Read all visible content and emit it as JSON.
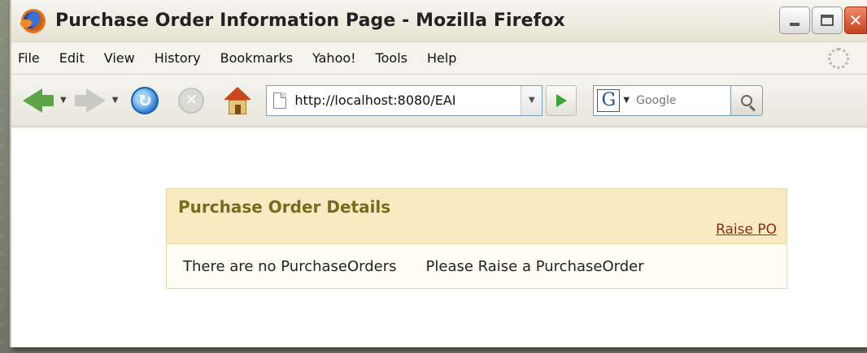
{
  "window": {
    "title": "Purchase Order Information Page - Mozilla Firefox",
    "buttons": {
      "minimize": "minimize",
      "maximize": "maximize",
      "close": "close"
    }
  },
  "menu": {
    "items": [
      {
        "label": "File"
      },
      {
        "label": "Edit"
      },
      {
        "label": "View"
      },
      {
        "label": "History"
      },
      {
        "label": "Bookmarks"
      },
      {
        "label": "Yahoo!"
      },
      {
        "label": "Tools"
      },
      {
        "label": "Help"
      }
    ]
  },
  "toolbar": {
    "url": "http://localhost:8080/EAI",
    "search_engine_letter": "G",
    "search_placeholder": "Google"
  },
  "page": {
    "panel_title": "Purchase Order Details",
    "raise_link": "Raise PO",
    "message_empty": "There are no PurchaseOrders",
    "message_action": "Please Raise a PurchaseOrder"
  },
  "colors": {
    "panel_header_bg": "#fbe9c2",
    "panel_title": "#7a6a1e",
    "link": "#8a2e10"
  }
}
